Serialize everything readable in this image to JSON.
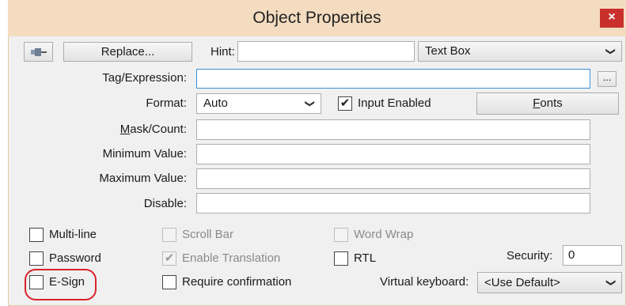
{
  "window": {
    "title": "Object Properties",
    "close_glyph": "×"
  },
  "row1": {
    "pin_icon": "pushpin-icon",
    "replace_label": "Replace...",
    "hint_label": "Hint:",
    "hint_value": "",
    "type_select": "Text Box"
  },
  "fields": {
    "tag_label": "Tag/Expression:",
    "tag_value": "",
    "tag_browse": "...",
    "format_label": "Format:",
    "format_value": "Auto",
    "input_enabled_label": "Input Enabled",
    "input_enabled_checked": true,
    "fonts_label_rest": "onts",
    "fonts_label_mnemonic": "F",
    "mask_label_mnemonic": "M",
    "mask_label_rest": "ask/Count:",
    "mask_value": "",
    "min_label": "Minimum Value:",
    "min_value": "",
    "max_label": "Maximum Value:",
    "max_value": "",
    "disable_label": "Disable:",
    "disable_value": ""
  },
  "options": {
    "multiline": "Multi-line",
    "scrollbar": "Scroll Bar",
    "wordwrap": "Word Wrap",
    "password": "Password",
    "enable_translation": "Enable Translation",
    "rtl": "RTL",
    "security_label": "Security:",
    "security_value": "0",
    "esign": "E-Sign",
    "require_confirmation": "Require confirmation",
    "virtual_keyboard_label": "Virtual keyboard:",
    "virtual_keyboard_value": "<Use Default>"
  },
  "colors": {
    "titlebar": "#f4dcc0",
    "close": "#c9302c",
    "highlight": "#d8242a",
    "focus": "#3c8fd6"
  }
}
